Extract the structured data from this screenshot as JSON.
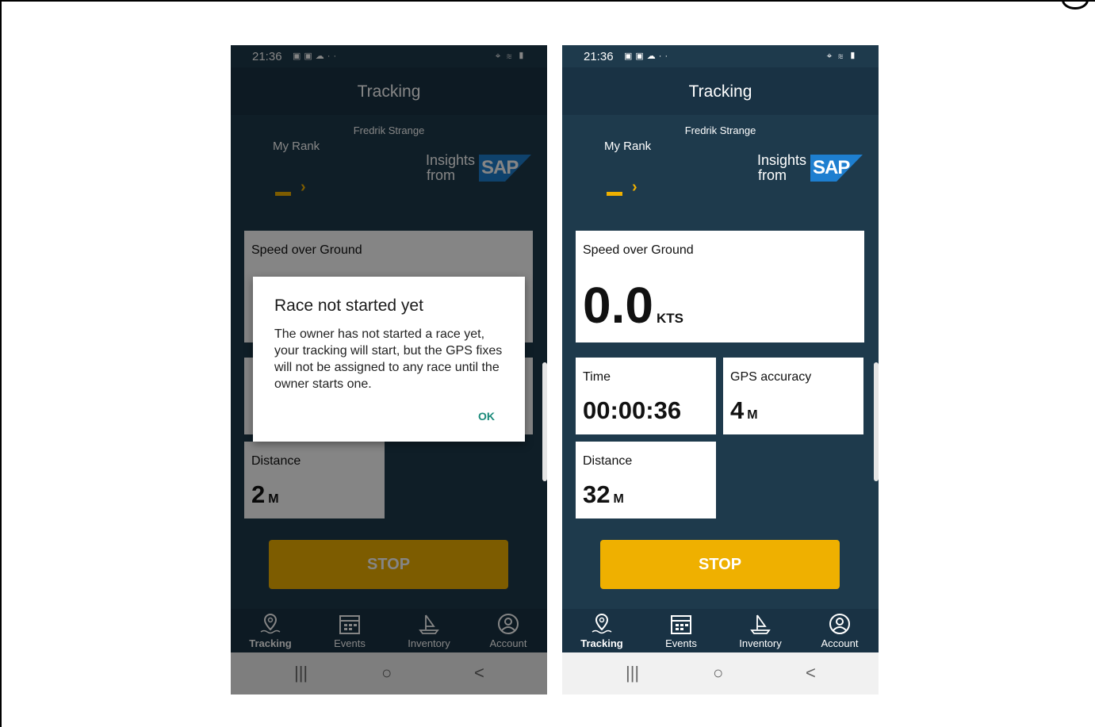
{
  "colors": {
    "primary": "#1e3a4c",
    "header": "#193244",
    "accent": "#efb000",
    "card": "#ffffff",
    "dialog_ok": "#1a8a7a"
  },
  "status_bar": {
    "time": "21:36",
    "notification_icons": [
      "image-icon",
      "photo-icon",
      "cloud-icon",
      "more-icon"
    ],
    "system_icons": [
      "location-icon",
      "wifi-icon",
      "signal-icon",
      "battery-icon"
    ]
  },
  "screen": {
    "title": "Tracking",
    "sailor_name": "Fredrik Strange",
    "my_rank_label": "My Rank",
    "rank_value": "—",
    "insights_line1": "Insights",
    "insights_line2": "from",
    "sap_logo": "SAP"
  },
  "left_phone": {
    "speed": {
      "label": "Speed over Ground"
    },
    "distance": {
      "label": "Distance",
      "value": "2",
      "unit": "M"
    },
    "stop_label": "STOP",
    "dialog": {
      "title": "Race not started yet",
      "message": "The owner has not started a race yet, your tracking will start, but the GPS fixes will not be assigned to any race until the owner starts one.",
      "ok_label": "OK"
    }
  },
  "right_phone": {
    "speed": {
      "label": "Speed over Ground",
      "value": "0.0",
      "unit": "KTS"
    },
    "time": {
      "label": "Time",
      "value": "00:00:36"
    },
    "gps_accuracy": {
      "label": "GPS accuracy",
      "value": "4",
      "unit": "M"
    },
    "distance": {
      "label": "Distance",
      "value": "32",
      "unit": "M"
    },
    "stop_label": "STOP"
  },
  "bottom_nav": [
    {
      "label": "Tracking",
      "icon": "location-pin-icon",
      "active": true
    },
    {
      "label": "Events",
      "icon": "calendar-icon",
      "active": false
    },
    {
      "label": "Inventory",
      "icon": "boat-icon",
      "active": false
    },
    {
      "label": "Account",
      "icon": "account-icon",
      "active": false
    }
  ],
  "system_nav": {
    "recents": "|||",
    "home": "○",
    "back": "<"
  }
}
